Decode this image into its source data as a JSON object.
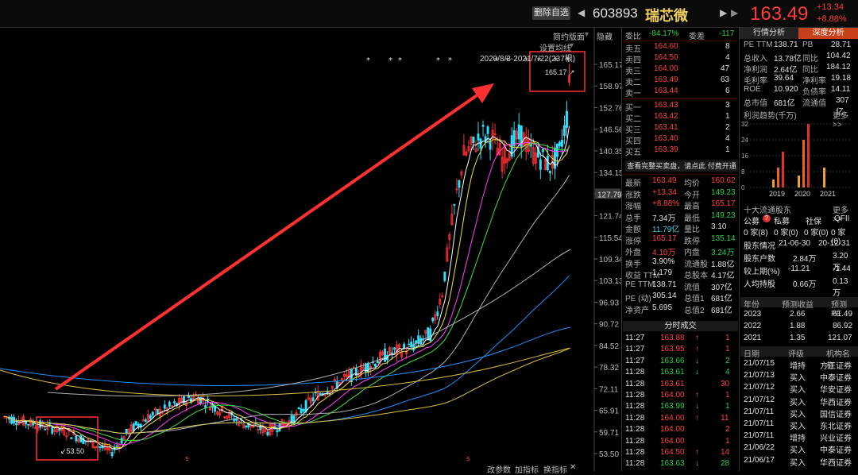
{
  "header": {
    "delete_watch": "删除自选",
    "code": "603893",
    "name": "瑞芯微",
    "price": "163.49",
    "change": "+13.34",
    "change_pct": "+8.88%"
  },
  "chart_toolbar": {
    "simple": "简约版面",
    "hide": "隐藏",
    "ma_settings": "设置均线",
    "range": "2020/8/3-2021/7/22(237根)",
    "bottom": [
      "改参数",
      "加指标",
      "换指标"
    ]
  },
  "chart_data": {
    "type": "candlestick",
    "y_ticks": [
      "165.17",
      "158.97",
      "152.76",
      "146.56",
      "140.35",
      "134.15",
      "127.79",
      "121.74",
      "115.54",
      "109.34",
      "103.13",
      "96.93",
      "90.72",
      "84.52",
      "78.32",
      "72.11",
      "65.91",
      "59.71",
      "53.50"
    ],
    "high_label": "165.17",
    "low_label": "53.50",
    "current_marker": "127.79",
    "ylim": [
      53.5,
      165.17
    ]
  },
  "quote": {
    "weibi_label": "委比",
    "weibi_val": "-84.17%",
    "weicha_label": "委差",
    "weicha_val": "-117",
    "asks": [
      {
        "label": "卖五",
        "price": "164.60",
        "vol": "8"
      },
      {
        "label": "卖四",
        "price": "164.50",
        "vol": "4"
      },
      {
        "label": "卖三",
        "price": "164.00",
        "vol": "47"
      },
      {
        "label": "卖二",
        "price": "163.49",
        "vol": "63"
      },
      {
        "label": "卖一",
        "price": "163.44",
        "vol": "6"
      }
    ],
    "bids": [
      {
        "label": "买一",
        "price": "163.43",
        "vol": "3"
      },
      {
        "label": "买二",
        "price": "163.42",
        "vol": "1"
      },
      {
        "label": "买三",
        "price": "163.41",
        "vol": "2"
      },
      {
        "label": "买四",
        "price": "163.40",
        "vol": "4"
      },
      {
        "label": "买五",
        "price": "163.39",
        "vol": "1"
      }
    ],
    "fullbook_btn": "查看完整买卖盘，请点此 付费开通",
    "stats": [
      [
        "最新",
        "163.49",
        "red",
        "均价",
        "160.62",
        "red"
      ],
      [
        "涨跌",
        "+13.34",
        "red",
        "今开",
        "149.23",
        "green"
      ],
      [
        "涨幅",
        "+8.88%",
        "red",
        "最高",
        "165.17",
        "red"
      ],
      [
        "总手",
        "7.34万",
        "white",
        "最低",
        "149.23",
        "green"
      ],
      [
        "金额",
        "11.79亿",
        "cyan",
        "量比",
        "3.10",
        "white"
      ],
      [
        "涨停",
        "165.17",
        "red",
        "跌停",
        "135.14",
        "green"
      ],
      [
        "外盘",
        "4.10万",
        "red",
        "内盘",
        "3.24万",
        "green"
      ],
      [
        "换手",
        "3.90%",
        "white",
        "流通股",
        "1.88亿",
        "white"
      ],
      [
        "收益 TTM",
        "1.179",
        "white",
        "总股本",
        "4.17亿",
        "white"
      ],
      [
        "PE TTM",
        "138.71",
        "white",
        "流值",
        "307亿",
        "white"
      ],
      [
        "PE (动)",
        "305.14",
        "white",
        "总值1",
        "681亿",
        "white"
      ],
      [
        "净资产",
        "5.695",
        "white",
        "总值2",
        "681亿",
        "white"
      ]
    ],
    "ticks_title": "分时成交",
    "ticks": [
      [
        "11:27",
        "163.88",
        "↑",
        "1",
        "red"
      ],
      [
        "11:27",
        "163.95",
        "↑",
        "1",
        "red"
      ],
      [
        "11:27",
        "163.66",
        "↓",
        "2",
        "green"
      ],
      [
        "11:28",
        "163.61",
        "↓",
        "4",
        "green"
      ],
      [
        "11:28",
        "163.61",
        "",
        "30",
        "red"
      ],
      [
        "11:28",
        "164.00",
        "↑",
        "1",
        "red"
      ],
      [
        "11:28",
        "163.99",
        "↓",
        "1",
        "green"
      ],
      [
        "11:28",
        "164.00",
        "↑",
        "11",
        "red"
      ],
      [
        "11:28",
        "164.00",
        "",
        "2",
        "red"
      ],
      [
        "11:28",
        "164.00",
        "",
        "1",
        "red"
      ],
      [
        "11:28",
        "164.50",
        "↑",
        "14",
        "red"
      ],
      [
        "11:28",
        "163.63",
        "↓",
        "28",
        "green"
      ]
    ]
  },
  "fund": {
    "tab1": "行情分析",
    "tab2": "深度分析",
    "rows": [
      [
        "PE TTM",
        "138.71",
        "PB",
        "28.71"
      ],
      [
        "总收入",
        "13.78亿",
        "同比",
        "104.42"
      ],
      [
        "净利润",
        "2.64亿",
        "同比",
        "184.12"
      ],
      [
        "毛利率",
        "39.64",
        "净利率",
        "19.18"
      ],
      [
        "ROE",
        "10.920",
        "负债率",
        "14.11"
      ],
      [
        "总市值",
        "681亿",
        "流通值",
        "307亿"
      ]
    ],
    "profit_title": "利润趋势(千万)",
    "more": "更多 >>",
    "profit_y": [
      "32",
      "24",
      "16",
      "8",
      "0"
    ],
    "profit_years": [
      "2019",
      "2020",
      "2021"
    ],
    "profit_bars": [
      4,
      10,
      18,
      6,
      24,
      32,
      0,
      10
    ],
    "holders_title": "十大流通股东",
    "holder_tabs": [
      "公募",
      "私募",
      "社保",
      "QFII"
    ],
    "holder_badge": "?",
    "holder_vals": [
      "0 家(8)",
      "0 家(0)",
      "0 家(0)",
      "0 家(0)"
    ],
    "holder_rows": [
      [
        "股东情况",
        "21-06-30",
        "20-12-31"
      ],
      [
        "股东户数",
        "2.84万",
        "3.20万"
      ],
      [
        "较上期(%)",
        "-11.21",
        "-1.44"
      ],
      [
        "人均持股",
        "0.66万",
        "0.13万"
      ]
    ],
    "forecast_head": [
      "年份",
      "预测收益",
      "预测PE"
    ],
    "forecast": [
      [
        "2023",
        "2.66",
        "61.49"
      ],
      [
        "2022",
        "1.88",
        "86.92"
      ],
      [
        "2021",
        "1.35",
        "121.07"
      ]
    ],
    "rating_head": [
      "日期",
      "评级",
      "机构名称"
    ],
    "ratings": [
      [
        "21/07/15",
        "增持",
        "方正证券"
      ],
      [
        "21/07/13",
        "买入",
        "中泰证券"
      ],
      [
        "21/07/12",
        "买入",
        "华安证券"
      ],
      [
        "21/07/12",
        "买入",
        "华西证券"
      ],
      [
        "21/07/11",
        "买入",
        "国信证券"
      ],
      [
        "21/07/11",
        "买入",
        "东北证券"
      ],
      [
        "21/07/11",
        "增持",
        "兴业证券"
      ],
      [
        "21/06/22",
        "买入",
        "中泰证券"
      ],
      [
        "21/06/17",
        "买入",
        "华西证券"
      ]
    ]
  }
}
